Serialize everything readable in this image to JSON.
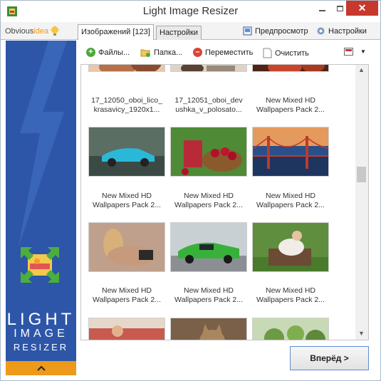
{
  "window": {
    "title": "Light Image Resizer",
    "close_glyph": "✕"
  },
  "header": {
    "logo_part1": "Obvious",
    "logo_part2": "idea",
    "tabs": [
      {
        "label": "Изображений [123]",
        "active": true
      },
      {
        "label": "Настройки",
        "active": false
      }
    ],
    "preview_label": "Предпросмотр",
    "settings_label": "Настройки"
  },
  "brand": {
    "line1": "LIGHT",
    "line2": "IMAGE",
    "line3": "RESIZER",
    "collapse_glyph": "⌃"
  },
  "toolbar": {
    "files_label": "Файлы...",
    "folder_label": "Папка...",
    "move_label": "Переместить",
    "clear_label": "Очистить",
    "view_menu_glyph": "▼"
  },
  "gallery": {
    "captions": [
      "17_12050_oboi_lico_\nkrasavicy_1920x1...",
      "17_12051_oboi_dev\nushka_v_polosato...",
      "New Mixed HD\nWallpapers Pack 2...",
      "New Mixed HD\nWallpapers Pack 2...",
      "New Mixed HD\nWallpapers Pack 2...",
      "New Mixed HD\nWallpapers Pack 2...",
      "New Mixed HD\nWallpapers Pack 2...",
      "New Mixed HD\nWallpapers Pack 2...",
      "New Mixed HD\nWallpapers Pack 2..."
    ],
    "thumbnails": [
      "woman-portrait",
      "woman-lying",
      "red-guitar",
      "blue-sports-car",
      "cherries-and-drink",
      "golden-gate-bridge",
      "woman-pose",
      "green-muscle-car",
      "girl-on-sofa",
      "beach-woman",
      "tabby-cat",
      "garden"
    ],
    "scroll_up": "▲",
    "scroll_down": "▼"
  },
  "footer": {
    "next_label": "Вперёд >"
  },
  "colors": {
    "brand_blue": "#2d56a8",
    "accent_orange": "#ed9a1a",
    "close_red": "#c7382d"
  }
}
